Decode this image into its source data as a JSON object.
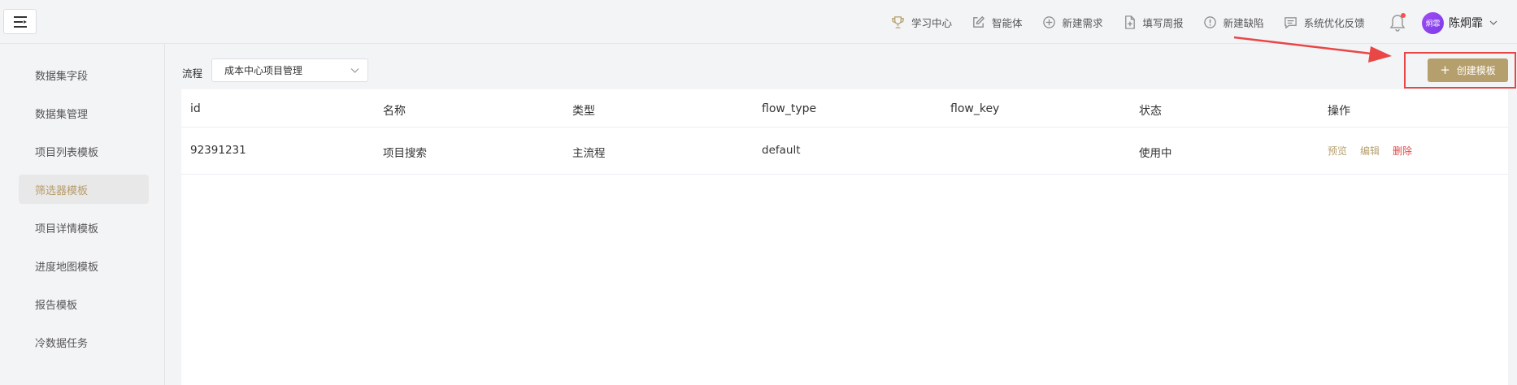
{
  "header": {
    "nav": [
      {
        "label": "学习中心",
        "icon": "trophy-icon"
      },
      {
        "label": "智能体",
        "icon": "edit-icon"
      },
      {
        "label": "新建需求",
        "icon": "plus-circle-icon"
      },
      {
        "label": "填写周报",
        "icon": "file-add-icon"
      },
      {
        "label": "新建缺陷",
        "icon": "exclamation-circle-icon"
      },
      {
        "label": "系统优化反馈",
        "icon": "message-icon"
      }
    ],
    "avatar_text": "炯霏",
    "username": "陈炯霏"
  },
  "sidebar": {
    "items": [
      {
        "label": "数据集字段"
      },
      {
        "label": "数据集管理"
      },
      {
        "label": "项目列表模板"
      },
      {
        "label": "筛选器模板"
      },
      {
        "label": "项目详情模板"
      },
      {
        "label": "进度地图模板"
      },
      {
        "label": "报告模板"
      },
      {
        "label": "冷数据任务"
      }
    ],
    "active_label": "筛选器模板"
  },
  "filter": {
    "label": "流程",
    "selected": "成本中心项目管理"
  },
  "toolbar": {
    "create_label": "创建模板",
    "create_plus": "+"
  },
  "table": {
    "columns": [
      "id",
      "名称",
      "类型",
      "flow_type",
      "flow_key",
      "状态",
      "操作"
    ],
    "rows": [
      {
        "id": "92391231",
        "name": "项目搜索",
        "type": "主流程",
        "flow_type": "default",
        "flow_key": "",
        "status": "使用中",
        "actions": {
          "preview": "预览",
          "edit": "编辑",
          "delete": "删除"
        }
      }
    ]
  },
  "colors": {
    "accent": "#b59f6d",
    "danger": "#e24a4a",
    "annotation": "#e94646"
  }
}
